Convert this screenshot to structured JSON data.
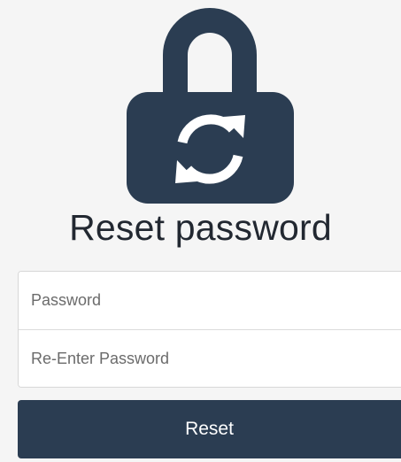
{
  "header": {
    "title": "Reset password",
    "icon": "lock-refresh-icon",
    "icon_color": "#2b3d52"
  },
  "form": {
    "password": {
      "placeholder": "Password",
      "value": ""
    },
    "confirm_password": {
      "placeholder": "Re-Enter Password",
      "value": ""
    },
    "submit_label": "Reset"
  },
  "colors": {
    "background": "#f5f5f5",
    "primary": "#2b3d52",
    "button_text": "#ffffff"
  }
}
